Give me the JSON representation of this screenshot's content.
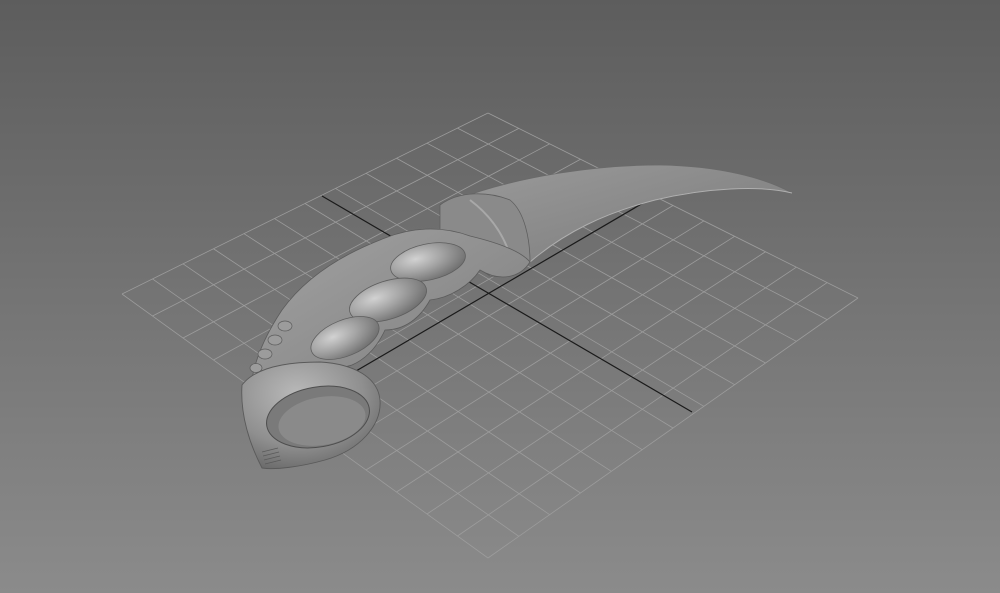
{
  "viewport": {
    "view": "perspective",
    "shading": "smooth",
    "model": "karambit-knife",
    "colors": {
      "background_top": "#5d5d5d",
      "background_bottom": "#8b8b8b",
      "grid_line": "#9c9c9c",
      "axis_line": "#1a1a1a",
      "model_base": "#8d8d8d",
      "model_highlight": "#c8c8c8",
      "model_shadow": "#5a5a5a"
    },
    "grid": {
      "visible": true,
      "divisions": 12
    }
  }
}
